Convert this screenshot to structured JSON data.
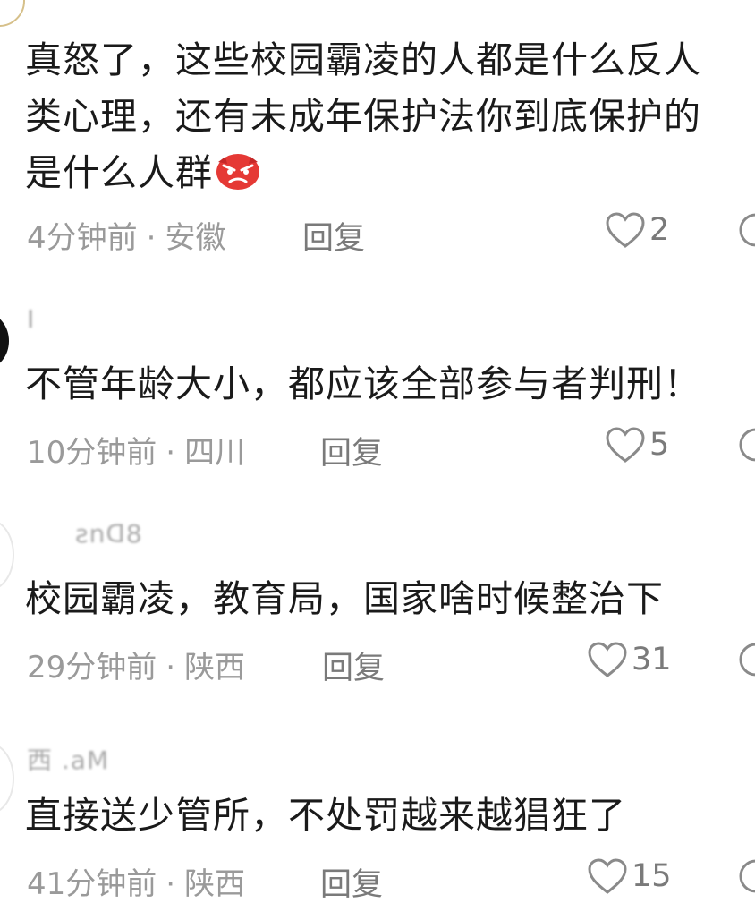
{
  "comments": [
    {
      "username": "",
      "text_lines": [
        "真怒了，这些校园霸凌的人都是什么反人",
        "类心理，还有未成年保护法你到底保护的",
        "是什么人群"
      ],
      "emoji": "angry-face-emoji",
      "time": "4分钟前",
      "location": "安徽",
      "reply_label": "回复",
      "likes": "2"
    },
    {
      "username": "I",
      "text_lines": [
        "不管年龄大小，都应该全部参与者判刑！"
      ],
      "time": "10分钟前",
      "location": "四川",
      "reply_label": "回复",
      "likes": "5"
    },
    {
      "username": "ƨnᗡ8",
      "text_lines": [
        "校园霸凌，教育局，国家啥时候整治下"
      ],
      "time": "29分钟前",
      "location": "陕西",
      "reply_label": "回复",
      "likes": "31"
    },
    {
      "username": "西 .aM",
      "text_lines": [
        "直接送少管所，不处罚越来越猖狂了"
      ],
      "time": "41分钟前",
      "location": "陕西",
      "reply_label": "回复",
      "likes": "15"
    }
  ],
  "separator": "·",
  "icons": {
    "like": "heart-outline-icon",
    "edge": "comment-bubble-icon"
  },
  "colors": {
    "text": "#1a1a1a",
    "meta": "#9a9a9a",
    "action": "#7a7a7a",
    "emoji": "#e53935"
  }
}
